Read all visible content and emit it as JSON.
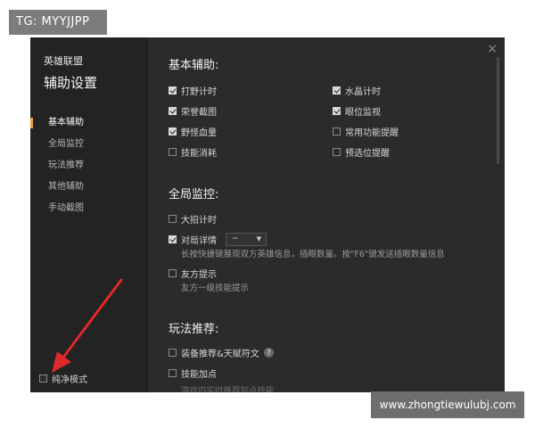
{
  "overlay": {
    "tag_text": "TG: MYYJJPP",
    "watermark_text": "www.zhongtiewulubj.com"
  },
  "window": {
    "game_title": "英雄联盟",
    "page_title": "辅助设置",
    "close_glyph": "×"
  },
  "sidebar": {
    "items": [
      {
        "label": "基本辅助",
        "active": true
      },
      {
        "label": "全局监控",
        "active": false
      },
      {
        "label": "玩法推荐",
        "active": false
      },
      {
        "label": "其他辅助",
        "active": false
      },
      {
        "label": "手动截图",
        "active": false
      }
    ],
    "pure_mode_label": "纯净模式"
  },
  "basic": {
    "title": "基本辅助:",
    "left": [
      {
        "label": "打野计时",
        "checked": true
      },
      {
        "label": "荣誉截图",
        "checked": true
      },
      {
        "label": "野怪血量",
        "checked": true
      },
      {
        "label": "技能消耗",
        "checked": false
      }
    ],
    "right": [
      {
        "label": "水晶计时",
        "checked": true
      },
      {
        "label": "眼位监视",
        "checked": true
      },
      {
        "label": "常用功能提醒",
        "checked": false
      },
      {
        "label": "预选位提醒",
        "checked": false
      }
    ]
  },
  "global": {
    "title": "全局监控:",
    "ult_timer": {
      "label": "大招计时",
      "checked": false
    },
    "match_detail": {
      "label": "对局详情",
      "checked": true,
      "select_value": "~",
      "desc": "长按快捷键展现双方英雄信息，插眼数量。按\"F6\"键发送插眼数量信息"
    },
    "ally_hint": {
      "label": "友方提示",
      "checked": false,
      "desc": "友方一级技能提示"
    }
  },
  "play": {
    "title": "玩法推荐:",
    "equip": {
      "label": "装备推荐&天赋符文",
      "checked": false,
      "help_glyph": "?"
    },
    "skill": {
      "label": "技能加点",
      "checked": false
    },
    "cut_desc": "游戏内实时推荐加点技能"
  }
}
